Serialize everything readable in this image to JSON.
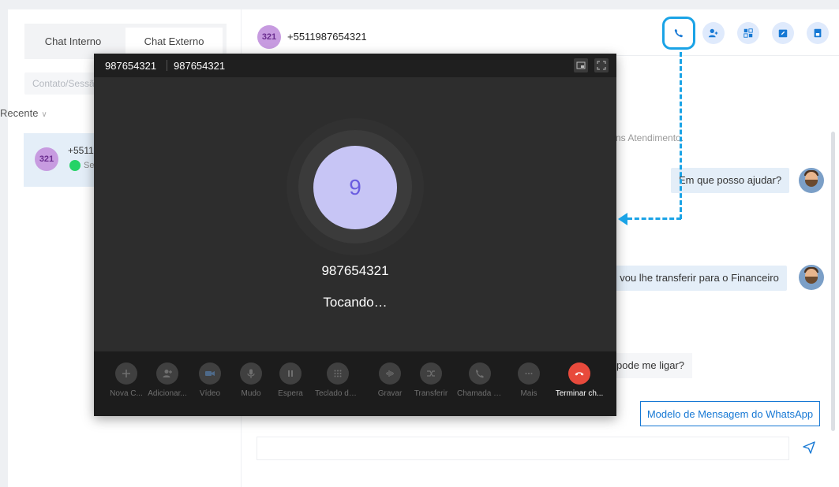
{
  "left": {
    "tabs": [
      "Chat Interno",
      "Chat Externo"
    ],
    "search_placeholder": "Contato/Sessão",
    "recent_label": "Recente",
    "conversation": {
      "avatar": "321",
      "phone": "+5511",
      "sub": "Se"
    }
  },
  "header": {
    "avatar": "321",
    "phone": "+5511987654321"
  },
  "messages": {
    "system": "ns Atendimento.",
    "agent_1": "Em que posso ajudar?",
    "agent_2": ", vou lhe transferir para o Financeiro",
    "customer_1": "pode me ligar?"
  },
  "composer": {
    "template_button": "Modelo de Mensagem do WhatsApp"
  },
  "call": {
    "title_number_1": "987654321",
    "title_number_2": "987654321",
    "avatar_letter": "9",
    "number": "987654321",
    "status": "Tocando…",
    "controls": [
      {
        "label": "Nova C...",
        "icon": "plus-icon"
      },
      {
        "label": "Adicionar...",
        "icon": "add-person-icon"
      },
      {
        "label": "Vídeo",
        "icon": "video-icon"
      },
      {
        "label": "Mudo",
        "icon": "microphone-icon"
      },
      {
        "label": "Espera",
        "icon": "pause-icon"
      },
      {
        "label": "Teclado de ...",
        "icon": "dialpad-icon"
      },
      {
        "label": "Gravar",
        "icon": "record-icon"
      },
      {
        "label": "Transferir",
        "icon": "transfer-icon"
      },
      {
        "label": "Chamada In...",
        "icon": "consult-call-icon"
      },
      {
        "label": "Mais",
        "icon": "more-icon"
      },
      {
        "label": "Terminar ch...",
        "icon": "hangup-icon"
      }
    ]
  },
  "colors": {
    "accent_blue": "#1aa3e6",
    "end_call_red": "#e84a3c",
    "avatar_purple": "#c79be0"
  }
}
